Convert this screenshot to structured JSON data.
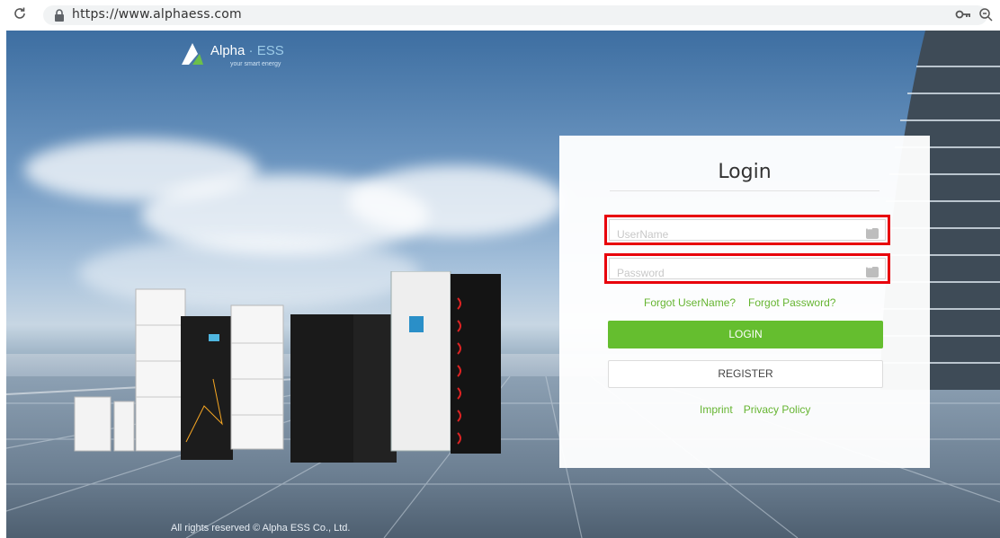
{
  "browser": {
    "url": "https://www.alphaess.com"
  },
  "brand": {
    "name": "Alpha",
    "suffix": "ESS",
    "tagline": "your smart energy"
  },
  "login": {
    "title": "Login",
    "username_placeholder": "UserName",
    "password_placeholder": "Password",
    "forgot_username": "Forgot UserName?",
    "forgot_password": "Forgot Password?",
    "login_button": "LOGIN",
    "register_button": "REGISTER",
    "imprint": "Imprint",
    "privacy_policy": "Privacy Policy"
  },
  "footer": {
    "copyright": "All rights reserved © Alpha ESS Co., Ltd."
  },
  "colors": {
    "accent_green": "#65be2f",
    "highlight_red": "#e8000b"
  }
}
